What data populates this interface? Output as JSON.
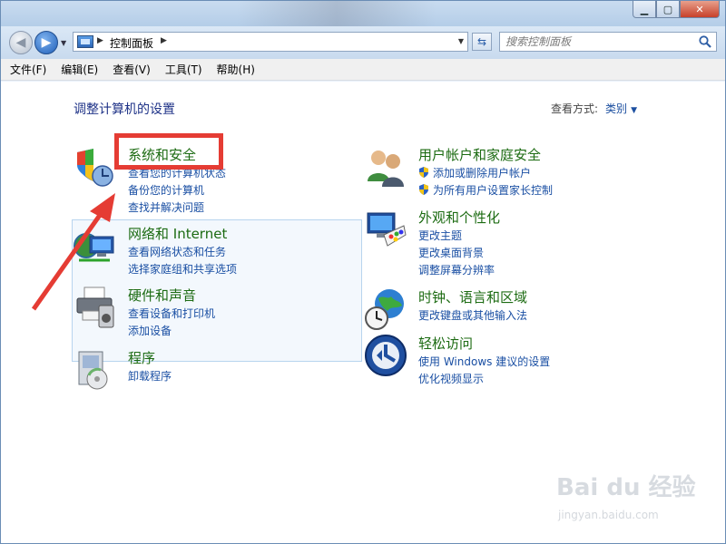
{
  "window": {
    "controls": {
      "minimize": "▁",
      "maximize": "▢",
      "close": "✕"
    }
  },
  "address": {
    "crumb": "控制面板",
    "search_placeholder": "搜索控制面板"
  },
  "menu": [
    "文件(F)",
    "编辑(E)",
    "查看(V)",
    "工具(T)",
    "帮助(H)"
  ],
  "main": {
    "title": "调整计算机的设置",
    "view_by_label": "查看方式:",
    "view_by_value": "类别"
  },
  "categories": [
    {
      "name": "system-security",
      "title": "系统和安全",
      "icon": "shield-icon",
      "links": [
        "查看您的计算机状态",
        "备份您的计算机",
        "查找并解决问题"
      ]
    },
    {
      "name": "network-internet",
      "title": "网络和 Internet",
      "icon": "network-icon",
      "links": [
        "查看网络状态和任务",
        "选择家庭组和共享选项"
      ]
    },
    {
      "name": "hardware-sound",
      "title": "硬件和声音",
      "icon": "printer-icon",
      "links": [
        "查看设备和打印机",
        "添加设备"
      ]
    },
    {
      "name": "programs",
      "title": "程序",
      "icon": "programs-icon",
      "links": [
        "卸载程序"
      ]
    },
    {
      "name": "user-accounts",
      "title": "用户帐户和家庭安全",
      "icon": "users-icon",
      "links": [
        "添加或删除用户帐户",
        "为所有用户设置家长控制"
      ]
    },
    {
      "name": "appearance",
      "title": "外观和个性化",
      "icon": "monitor-palette-icon",
      "links": [
        "更改主题",
        "更改桌面背景",
        "调整屏幕分辨率"
      ]
    },
    {
      "name": "clock-region",
      "title": "时钟、语言和区域",
      "icon": "globe-clock-icon",
      "links": [
        "更改键盘或其他输入法"
      ]
    },
    {
      "name": "ease-access",
      "title": "轻松访问",
      "icon": "ease-of-access-icon",
      "links": [
        "使用 Windows 建议的设置",
        "优化视频显示"
      ]
    }
  ],
  "watermark": {
    "brand": "Bai du 经验",
    "url": "jingyan.baidu.com"
  },
  "colors": {
    "category_title": "#1c6b12",
    "link": "#1a4fa3",
    "annotation": "#e53c34"
  }
}
